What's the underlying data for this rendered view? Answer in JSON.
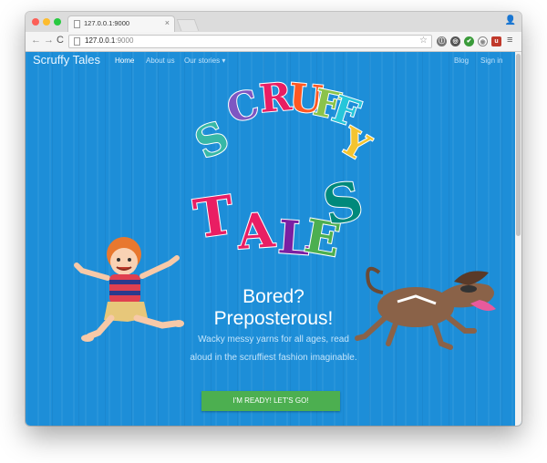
{
  "browser": {
    "tab_title": "127.0.0.1:9000",
    "tab_close": "×",
    "url_host": "127.0.0.1",
    "url_port": ":9000",
    "back": "←",
    "forward": "→",
    "reload": "C",
    "star": "☆",
    "menu": "≡",
    "extensions": [
      "ⓘ",
      "◎",
      "✔",
      "◉",
      "u"
    ]
  },
  "navbar": {
    "brand": "Scruffy Tales",
    "links": [
      "Home",
      "About us",
      "Our stories"
    ],
    "dropdown_caret": "▾",
    "right_links": [
      "Blog",
      "Sign in"
    ]
  },
  "logo": {
    "top": [
      "S",
      "C",
      "R",
      "U",
      "F",
      "F",
      "Y"
    ],
    "bottom": [
      "T",
      "A",
      "L",
      "E",
      "S"
    ]
  },
  "hero": {
    "headline_line1": "Bored?",
    "headline_line2": "Preposterous!",
    "tagline": "Wacky messy yarns for all ages, read aloud in the scruffiest fashion imaginable.",
    "cta": "I'M READY! LET'S GO!"
  },
  "colors": {
    "page_bg": "#1d8ed8",
    "cta": "#4caf50",
    "logo_letters": [
      "#37b8a6",
      "#7e57c2",
      "#e91e63",
      "#ff5722",
      "#8bc34a",
      "#26c6da",
      "#f4c430",
      "#e91e63",
      "#e91e63",
      "#7b1fa2",
      "#4caf50",
      "#00897b"
    ]
  }
}
